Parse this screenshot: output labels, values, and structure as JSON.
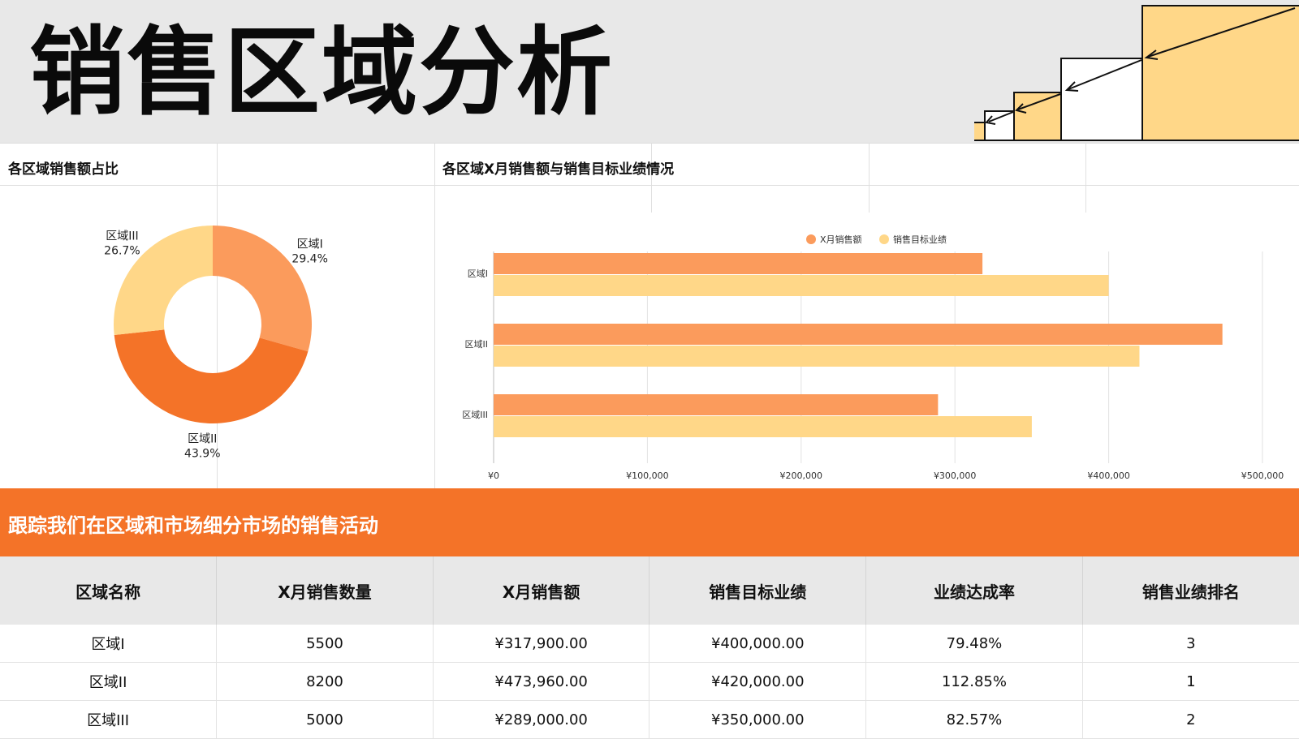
{
  "page": {
    "title": "销售区域分析"
  },
  "panels": {
    "donut_title": "各区域销售额占比",
    "bar_title": "各区域X月销售额与销售目标业绩情况"
  },
  "banner": {
    "text": "跟踪我们在区域和市场细分市场的销售活动"
  },
  "colors": {
    "orange": "#f47328",
    "light_orange": "#fb9b5c",
    "yellow": "#ffd788",
    "banner": "#f47328",
    "header_bg": "#e8e8e8"
  },
  "table": {
    "headers": [
      "区域名称",
      "X月销售数量",
      "X月销售额",
      "销售目标业绩",
      "业绩达成率",
      "销售业绩排名"
    ],
    "rows": [
      [
        "区域I",
        "5500",
        "¥317,900.00",
        "¥400,000.00",
        "79.48%",
        "3"
      ],
      [
        "区域II",
        "8200",
        "¥473,960.00",
        "¥420,000.00",
        "112.85%",
        "1"
      ],
      [
        "区域III",
        "5000",
        "¥289,000.00",
        "¥350,000.00",
        "82.57%",
        "2"
      ]
    ]
  },
  "chart_data": [
    {
      "type": "pie",
      "variant": "donut",
      "title": "各区域销售额占比",
      "slices": [
        {
          "label": "区域I",
          "value": 29.4,
          "display": "29.4%",
          "color": "#fb9b5c"
        },
        {
          "label": "区域II",
          "value": 43.9,
          "display": "43.9%",
          "color": "#f47328"
        },
        {
          "label": "区域III",
          "value": 26.7,
          "display": "26.7%",
          "color": "#ffd788"
        }
      ]
    },
    {
      "type": "bar",
      "orientation": "horizontal",
      "title": "各区域X月销售额与销售目标业绩情况",
      "categories": [
        "区域I",
        "区域II",
        "区域III"
      ],
      "series": [
        {
          "name": "X月销售额",
          "values": [
            317900,
            473960,
            289000
          ],
          "color": "#fb9b5c"
        },
        {
          "name": "销售目标业绩",
          "values": [
            400000,
            420000,
            350000
          ],
          "color": "#ffd788"
        }
      ],
      "xlim": [
        0,
        500000
      ],
      "xticks": [
        "¥0",
        "¥100,000",
        "¥200,000",
        "¥300,000",
        "¥400,000",
        "¥500,000"
      ],
      "legend": "top",
      "grid": true
    }
  ]
}
